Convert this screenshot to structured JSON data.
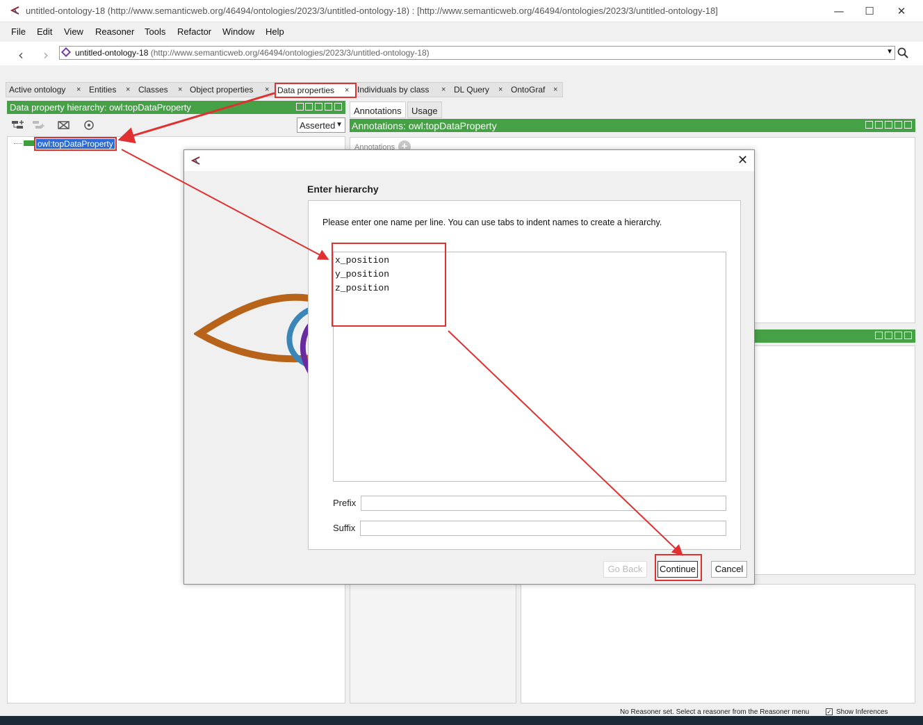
{
  "window": {
    "title": "untitled-ontology-18 (http://www.semanticweb.org/46494/ontologies/2023/3/untitled-ontology-18)  : [http://www.semanticweb.org/46494/ontologies/2023/3/untitled-ontology-18]",
    "minimize": "—",
    "maximize": "☐",
    "close": "✕"
  },
  "menu": [
    "File",
    "Edit",
    "View",
    "Reasoner",
    "Tools",
    "Refactor",
    "Window",
    "Help"
  ],
  "address": {
    "ontology_name": "untitled-ontology-18",
    "ontology_uri": "(http://www.semanticweb.org/46494/ontologies/2023/3/untitled-ontology-18)"
  },
  "tabs": [
    {
      "label": "Active ontology"
    },
    {
      "label": "Entities"
    },
    {
      "label": "Classes"
    },
    {
      "label": "Object properties"
    },
    {
      "label": "Data properties",
      "active": true
    },
    {
      "label": "Individuals by class"
    },
    {
      "label": "DL Query"
    },
    {
      "label": "OntoGraf"
    }
  ],
  "tab_close": "×",
  "left_pane": {
    "header": "Data property hierarchy: owl:topDataProperty",
    "mode": "Asserted",
    "tree_root": "owl:topDataProperty"
  },
  "right_pane": {
    "tabs": [
      "Annotations",
      "Usage"
    ],
    "header": "Annotations: owl:topDataProperty",
    "annotations_label": "Annotations"
  },
  "status": {
    "message": "No Reasoner set. Select a reasoner from the Reasoner menu",
    "show_inferences": "Show Inferences"
  },
  "dialog": {
    "heading": "Enter hierarchy",
    "instruction": "Please enter one name per line. You can use tabs to indent names to create a hierarchy.",
    "names": [
      "x_position",
      "y_position",
      "z_position"
    ],
    "prefix_label": "Prefix",
    "suffix_label": "Suffix",
    "prefix_value": "",
    "suffix_value": "",
    "buttons": {
      "back": "Go Back",
      "continue": "Continue",
      "cancel": "Cancel"
    },
    "close": "✕"
  },
  "colors": {
    "header_green": "#46a046",
    "annotation_red": "#e03030",
    "selection_blue": "#2b6bd6"
  },
  "icons": {
    "app": "protege-icon",
    "search": "search-icon",
    "nav_back": "chevron-left-icon",
    "nav_forward": "chevron-right-icon"
  }
}
